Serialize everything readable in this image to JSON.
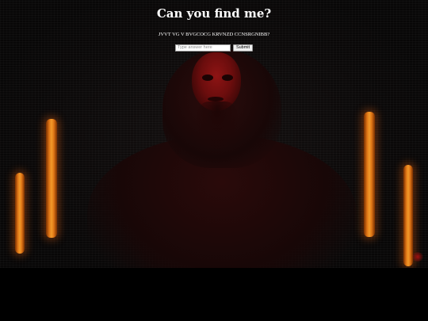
{
  "page": {
    "title": "Can you find me?",
    "cipher_text": "JVVT VG V BVGCOCG KRVNZD CCNSRGNIBB?"
  },
  "form": {
    "answer_placeholder": "Type answer here",
    "answer_value": "",
    "submit_label": "Submit"
  },
  "colors": {
    "background": "#000000",
    "text": "#ffffff",
    "face_red": "#8e1414",
    "light_orange": "#f29a2a"
  }
}
